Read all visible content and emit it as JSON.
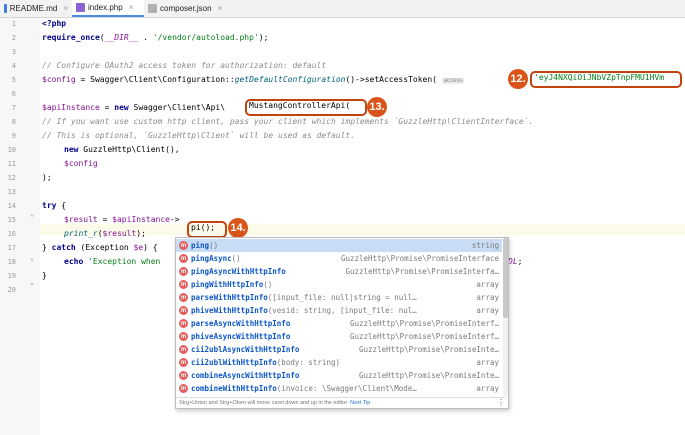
{
  "tabs": [
    {
      "label": "README.md",
      "icon": "markdown-file-icon"
    },
    {
      "label": "index.php",
      "icon": "php-file-icon"
    },
    {
      "label": "composer.json",
      "icon": "json-file-icon"
    }
  ],
  "line_numbers": [
    "1",
    "2",
    "3",
    "4",
    "5",
    "6",
    "7",
    "8",
    "9",
    "10",
    "11",
    "12",
    "13",
    "14",
    "15",
    "16",
    "17",
    "18",
    "19",
    "20"
  ],
  "code": {
    "l1": "<?php",
    "l2a": "require_once",
    "l2b": "(",
    "l2c": "__DIR__",
    "l2d": " . ",
    "l2e": "'/vendor/autoload.php'",
    "l2f": ");",
    "l4": "// Configure OAuth2 access token for authorization: default",
    "l5a": "$config",
    "l5b": " = Swagger\\Client\\Configuration::",
    "l5c": "getDefaultConfiguration",
    "l5d": "()->setAccessToken( ",
    "l5hint": "access",
    "l7a": "$apiInstance",
    "l7b": " = ",
    "l7c": "new",
    "l7d": " Swagger\\Client\\Api\\",
    "l8": "// If you want use custom http client, pass your client which implements `GuzzleHttp\\ClientInterface`.",
    "l9": "// This is optional, `GuzzleHttp\\Client` will be used as default.",
    "l10a": "new",
    "l10b": " GuzzleHttp\\Client(),",
    "l11": "$config",
    "l12": ");",
    "l14a": "try",
    "l14b": " {",
    "l15a": "$result",
    "l15b": " = ",
    "l15c": "$apiInstance",
    "l15d": "->",
    "l16a": "print_r",
    "l16b": "(",
    "l16c": "$result",
    "l16d": ");",
    "l17a": "} ",
    "l17b": "catch",
    "l17c": " (Exception ",
    "l17d": "$e",
    "l17e": ") {",
    "l18a": "echo",
    "l18b": " 'Exception when",
    "l18c": "DL",
    "l18d": ";",
    "l19": "}"
  },
  "highlights": {
    "token": "'eyJ4NXQiOiJNbVZpTnpFMU1HVm",
    "controller": "MustangControllerApi(",
    "method": "pi(",
    "method_close": ");"
  },
  "badges": [
    "12.",
    "13.",
    "14."
  ],
  "completion": {
    "items": [
      {
        "prefix": "p",
        "match": "ing",
        "sig": "()",
        "type": "string"
      },
      {
        "prefix": "p",
        "match": "ing",
        "rest": "Async",
        "sig": "()",
        "type": "GuzzleHttp\\Promise\\PromiseInterface"
      },
      {
        "prefix": "p",
        "match": "ing",
        "rest": "AsyncWithHttpInfo",
        "sig": "",
        "type": "GuzzleHttp\\Promise\\PromiseInterfa…"
      },
      {
        "prefix": "p",
        "match": "ing",
        "rest": "WithHttpInfo",
        "sig": "()",
        "type": "array"
      },
      {
        "prefix": "parseWithHtt",
        "match": "p",
        "rest": "Info",
        "sig": "([input_file: null|string = null…",
        "type": "array"
      },
      {
        "prefix": "phiveWithHtt",
        "match": "p",
        "rest": "Info",
        "sig": "(vesid: string, [input_file: nul…",
        "type": "array"
      },
      {
        "prefix": "parseAsyncWithHtt",
        "match": "p",
        "rest": "Info",
        "sig": "",
        "type": "GuzzleHttp\\Promise\\PromiseInterf…"
      },
      {
        "prefix": "phiveAsyncWithHtt",
        "match": "p",
        "rest": "Info",
        "sig": "",
        "type": "GuzzleHttp\\Promise\\PromiseInterf…"
      },
      {
        "prefix": "cii2ublAsyncWithHtt",
        "match": "p",
        "rest": "Info",
        "sig": "",
        "type": "GuzzleHttp\\Promise\\PromiseInte…"
      },
      {
        "prefix": "cii2ublWithHtt",
        "match": "p",
        "rest": "Info",
        "sig": "(body: string)",
        "type": "array"
      },
      {
        "prefix": "combineAsyncWithHtt",
        "match": "p",
        "rest": "Info",
        "sig": "",
        "type": "GuzzleHttp\\Promise\\PromiseInte…"
      },
      {
        "prefix": "combineWithHtt",
        "match": "p",
        "rest": "Info",
        "sig": "(invoice: \\Swagger\\Client\\Mode…",
        "type": "array"
      }
    ],
    "footer_text": "Strg+Unten and Strg+Oben will move caret down and up in the editor",
    "footer_link": "Next Tip",
    "menu_glyph": "⋮"
  },
  "colors": {
    "accent": "#d8541a",
    "selection": "#c9dcf5",
    "method_icon": "#e35d5d"
  }
}
